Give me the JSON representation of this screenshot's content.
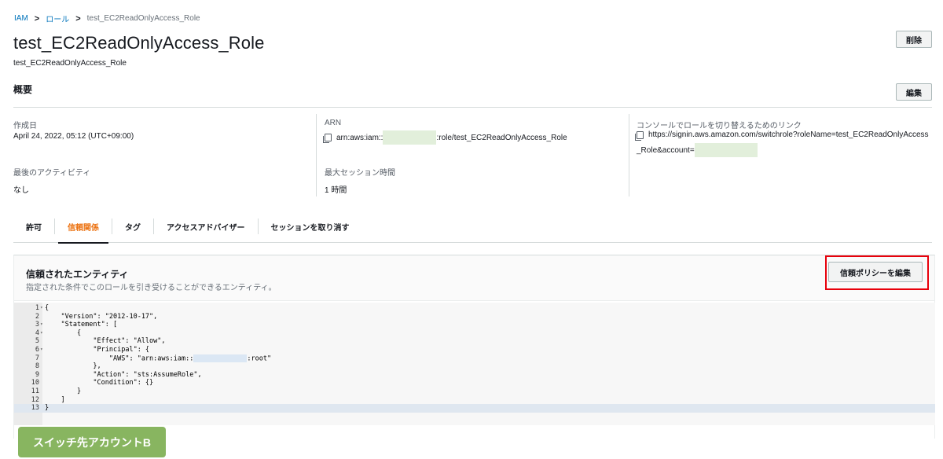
{
  "breadcrumb": {
    "items": [
      "IAM",
      "ロール",
      "test_EC2ReadOnlyAccess_Role"
    ],
    "separator": ">"
  },
  "header": {
    "title": "test_EC2ReadOnlyAccess_Role",
    "subtitle": "test_EC2ReadOnlyAccess_Role",
    "delete_label": "削除"
  },
  "summary": {
    "title": "概要",
    "edit_label": "編集",
    "created_label": "作成日",
    "created_value": "April 24, 2022, 05:12 (UTC+09:00)",
    "arn_label": "ARN",
    "arn_prefix": "arn:aws:iam::",
    "arn_suffix": ":role/test_EC2ReadOnlyAccess_Role",
    "switch_link_label": "コンソールでロールを切り替えるためのリンク",
    "switch_link_value_1": "https://signin.aws.amazon.com/switchrole?roleName=test_EC2ReadOnlyAccess",
    "switch_link_value_2": "_Role&account=",
    "last_activity_label": "最後のアクティビティ",
    "last_activity_value": "なし",
    "max_session_label": "最大セッション時間",
    "max_session_value": "1 時間"
  },
  "tabs": [
    {
      "label": "許可",
      "active": false
    },
    {
      "label": "信頼関係",
      "active": true
    },
    {
      "label": "タグ",
      "active": false
    },
    {
      "label": "アクセスアドバイザー",
      "active": false
    },
    {
      "label": "セッションを取り消す",
      "active": false
    }
  ],
  "trusted_entities": {
    "title": "信頼されたエンティティ",
    "description": "指定された条件でこのロールを引き受けることができるエンティティ。",
    "edit_policy_label": "信頼ポリシーを編集"
  },
  "code_lines": [
    {
      "n": "1",
      "fold": "▾",
      "text": "{"
    },
    {
      "n": "2",
      "fold": "",
      "text": "    \"Version\": \"2012-10-17\","
    },
    {
      "n": "3",
      "fold": "▾",
      "text": "    \"Statement\": ["
    },
    {
      "n": "4",
      "fold": "▾",
      "text": "        {"
    },
    {
      "n": "5",
      "fold": "",
      "text": "            \"Effect\": \"Allow\","
    },
    {
      "n": "6",
      "fold": "▾",
      "text": "            \"Principal\": {"
    },
    {
      "n": "7",
      "fold": "",
      "text": "                \"AWS\": \"arn:aws:iam::",
      "masked": true,
      "after": ":root\""
    },
    {
      "n": "8",
      "fold": "",
      "text": "            },"
    },
    {
      "n": "9",
      "fold": "",
      "text": "            \"Action\": \"sts:AssumeRole\","
    },
    {
      "n": "10",
      "fold": "",
      "text": "            \"Condition\": {}"
    },
    {
      "n": "11",
      "fold": "",
      "text": "        }"
    },
    {
      "n": "12",
      "fold": "",
      "text": "    ]"
    },
    {
      "n": "13",
      "fold": "",
      "text": "}"
    }
  ],
  "annotation": {
    "badge_label": "スイッチ先アカウントB",
    "highlight_color": "#e8000b",
    "badge_color": "#88b560"
  }
}
